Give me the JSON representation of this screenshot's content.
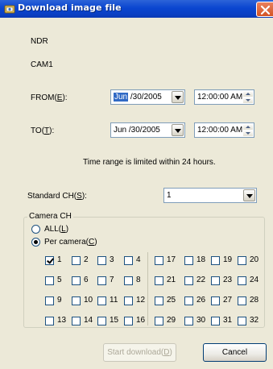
{
  "window": {
    "title": "Download image file",
    "title_icon": "download-app-icon",
    "close_icon": "close-icon"
  },
  "device": {
    "name": "NDR",
    "camera": "CAM1"
  },
  "from": {
    "label": "FROM(",
    "mnemonic": "E",
    "label_end": "):",
    "date_selected_part": "Jun",
    "date_rest": " /30/2005",
    "time": "12:00:00 AM"
  },
  "to": {
    "label": "TO(",
    "mnemonic": "T",
    "label_end": "):",
    "date": "Jun /30/2005",
    "time": "12:00:00 AM"
  },
  "notice": "Time range is limited within 24 hours.",
  "standard_ch": {
    "label": "Standard CH(",
    "mnemonic": "S",
    "label_end": "):",
    "value": "1"
  },
  "camera_ch": {
    "title": "Camera CH",
    "all_label": "ALL(",
    "all_mnemonic": "L",
    "all_end": ")",
    "per_label": "Per camera(",
    "per_mnemonic": "C",
    "per_end": ")",
    "mode": "per_camera",
    "channels": [
      [
        "1",
        "2",
        "3",
        "4",
        "17",
        "18",
        "19",
        "20"
      ],
      [
        "5",
        "6",
        "7",
        "8",
        "21",
        "22",
        "23",
        "24"
      ],
      [
        "9",
        "10",
        "11",
        "12",
        "25",
        "26",
        "27",
        "28"
      ],
      [
        "13",
        "14",
        "15",
        "16",
        "29",
        "30",
        "31",
        "32"
      ]
    ],
    "checked": [
      "1"
    ]
  },
  "buttons": {
    "start": "Start download(",
    "start_mnemonic": "D",
    "start_end": ")",
    "start_enabled": false,
    "cancel": "Cancel"
  },
  "colors": {
    "titlebar": "#0a46d0",
    "dialog_bg": "#ece9d8",
    "selection": "#316ac5"
  }
}
